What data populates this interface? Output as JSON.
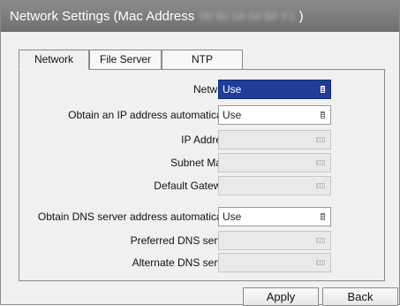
{
  "window": {
    "title": "Network Settings (Mac Address",
    "mac_address": "00 80 0A 04 BF F1",
    "title_suffix": ")"
  },
  "tabs": [
    {
      "label": "Network",
      "active": true
    },
    {
      "label": "File Server",
      "active": false
    },
    {
      "label": "NTP",
      "active": false
    }
  ],
  "network": {
    "network": {
      "label": "Network",
      "value": "Use"
    },
    "obtain_ip": {
      "label": "Obtain an IP address automatically",
      "value": "Use"
    },
    "ip_address": {
      "label": "IP Address",
      "value": ""
    },
    "subnet_mask": {
      "label": "Subnet Mask",
      "value": ""
    },
    "default_gateway": {
      "label": "Default Gateway",
      "value": ""
    },
    "obtain_dns": {
      "label": "Obtain DNS server address automatically",
      "value": "Use"
    },
    "preferred_dns": {
      "label": "Preferred DNS server",
      "value": ""
    },
    "alternate_dns": {
      "label": "Alternate DNS server",
      "value": ""
    }
  },
  "buttons": {
    "apply": "Apply",
    "back": "Back"
  },
  "colors": {
    "titlebar": "#7d7d7d",
    "selected_dropdown": "#1f3d99"
  }
}
